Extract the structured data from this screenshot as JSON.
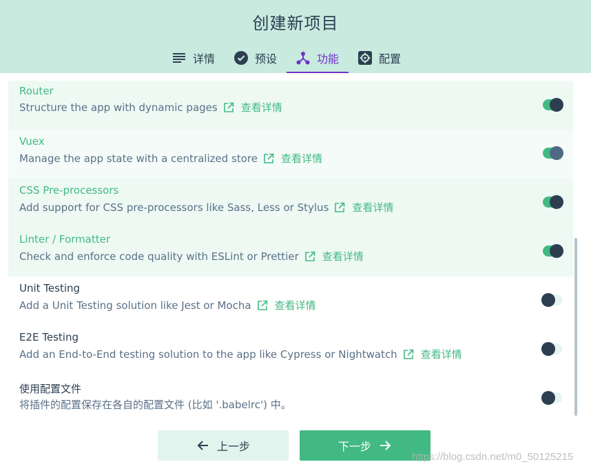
{
  "header": {
    "title": "创建新项目",
    "tabs": [
      {
        "label": "详情",
        "icon": "list-icon",
        "active": false
      },
      {
        "label": "预设",
        "icon": "check-circle-icon",
        "active": false
      },
      {
        "label": "功能",
        "icon": "features-icon",
        "active": true
      },
      {
        "label": "配置",
        "icon": "gear-icon",
        "active": false
      }
    ]
  },
  "features": [
    {
      "name": "Router",
      "description": "Structure the app with dynamic pages",
      "more": "查看详情",
      "enabled": true
    },
    {
      "name": "Vuex",
      "description": "Manage the app state with a centralized store",
      "more": "查看详情",
      "enabled": true
    },
    {
      "name": "CSS Pre-processors",
      "description": "Add support for CSS pre-processors like Sass, Less or Stylus",
      "more": "查看详情",
      "enabled": true
    },
    {
      "name": "Linter / Formatter",
      "description": "Check and enforce code quality with ESLint or Prettier",
      "more": "查看详情",
      "enabled": true
    },
    {
      "name": "Unit Testing",
      "description": "Add a Unit Testing solution like Jest or Mocha",
      "more": "查看详情",
      "enabled": false
    },
    {
      "name": "E2E Testing",
      "description": "Add an End-to-End testing solution to the app like Cypress or Nightwatch",
      "more": "查看详情",
      "enabled": false
    },
    {
      "name": "使用配置文件",
      "description": "将插件的配置保存在各自的配置文件 (比如 '.babelrc') 中。",
      "more": "",
      "enabled": false
    }
  ],
  "footer": {
    "prev_label": "上一步",
    "next_label": "下一步"
  },
  "watermark": "https://blog.csdn.net/m0_50125215",
  "colors": {
    "header_bg": "#c8eadf",
    "accent_green": "#42b983",
    "accent_purple": "#6f32c9",
    "dark": "#2c3e50"
  }
}
